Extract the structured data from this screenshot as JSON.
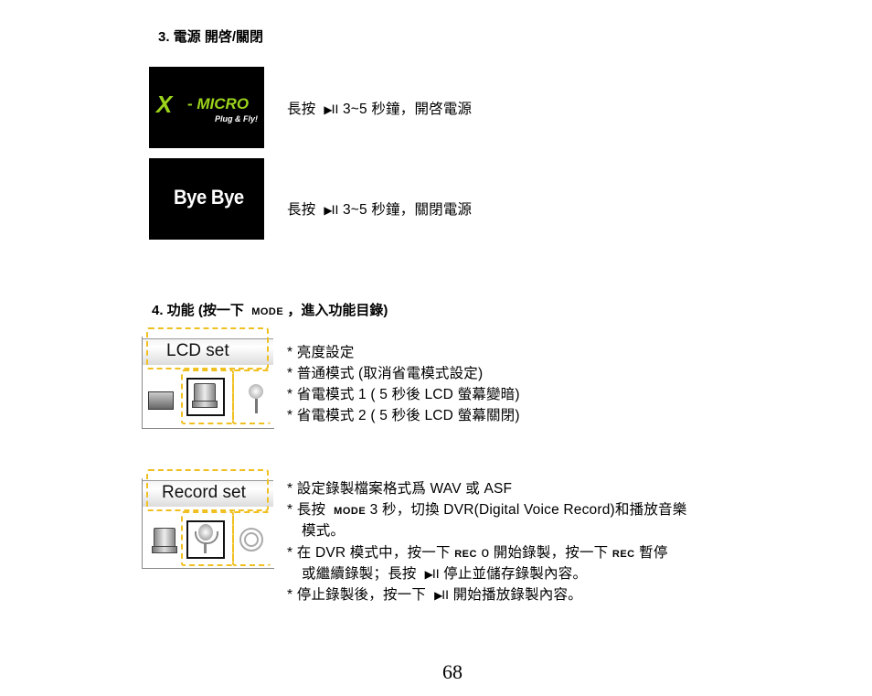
{
  "section3": {
    "heading": "3.  電源  開啓/關閉",
    "items": [
      {
        "image": {
          "brand_x": "X",
          "brand_text": "- MICRO",
          "tagline": "Plug & Fly!"
        },
        "text_pre": "長按",
        "icon": "play-pause-icon",
        "text_post": "3~5  秒鐘，開啓電源"
      },
      {
        "image": {
          "screen_text": "Bye Bye"
        },
        "text_pre": "長按",
        "icon": "play-pause-icon",
        "text_post": "3~5  秒鐘，關閉電源"
      }
    ]
  },
  "section4": {
    "heading_pre": "4.  功能  (按一下",
    "heading_key": "MODE",
    "heading_post": "，進入功能目錄)",
    "lcd": {
      "menu_label": "LCD set",
      "bullets": [
        "*  亮度設定",
        "*  普通模式  (取消省電模式設定)",
        "*  省電模式  1 ( 5  秒後 LCD 螢幕變暗)",
        "*  省電模式  2 ( 5  秒後 LCD 螢幕關閉)"
      ]
    },
    "record": {
      "menu_label": "Record set",
      "bullet1": "*  設定錄製檔案格式爲 WAV  或  ASF",
      "bullet2_pre": "*  長按",
      "bullet2_key": "MODE",
      "bullet2_post": "3  秒，切換 DVR(Digital  Voice  Record)和播放音樂",
      "bullet2_cont": "模式。",
      "bullet3_a": "*  在  DVR  模式中，按一下",
      "bullet3_key1": "REC",
      "bullet3_b": "o  開始錄製，按一下",
      "bullet3_key2": "REC",
      "bullet3_c": "暫停",
      "bullet3_cont_pre": "或繼續錄製；長按",
      "bullet3_cont_post": "停止並儲存錄製內容。",
      "bullet4_pre": "*  停止錄製後，按一下",
      "bullet4_post": "開始播放錄製內容。"
    }
  },
  "playpause_glyph": {
    "tri": "▶",
    "bars": "II"
  },
  "page_number": "68",
  "colors": {
    "accent_green": "#9bd21b",
    "dash_yellow": "#f0c020"
  }
}
